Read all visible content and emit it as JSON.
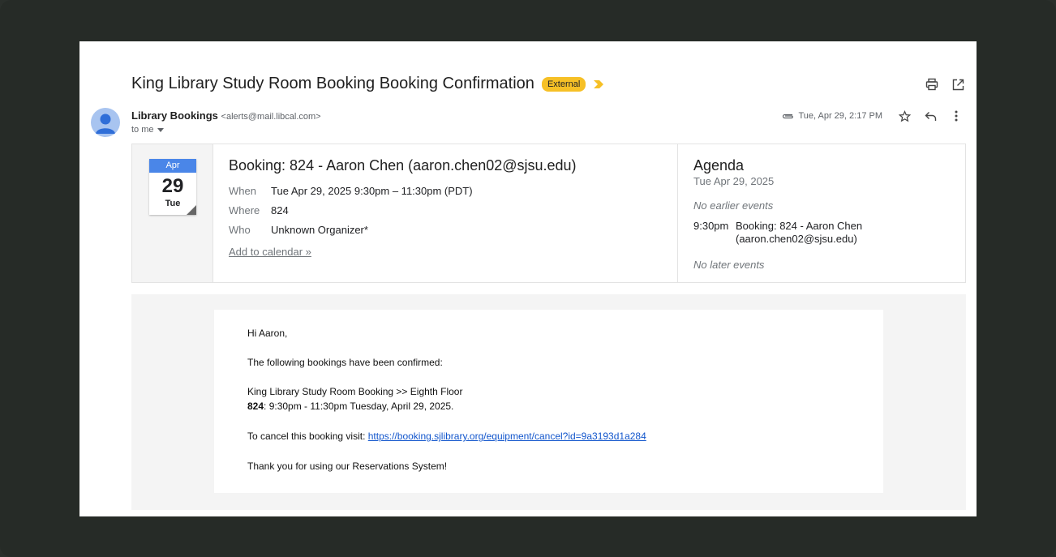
{
  "email": {
    "subject": "King Library Study Room Booking Booking Confirmation",
    "badge": "External",
    "sender_name": "Library Bookings",
    "sender_email": "<alerts@mail.libcal.com>",
    "to_label": "to me",
    "date": "Tue, Apr 29, 2:17 PM"
  },
  "invite": {
    "month": "Apr",
    "day": "29",
    "dow": "Tue",
    "title": "Booking: 824 - Aaron Chen (aaron.chen02@sjsu.edu)",
    "rows": [
      {
        "k": "When",
        "v": "Tue Apr 29, 2025 9:30pm – 11:30pm (PDT)"
      },
      {
        "k": "Where",
        "v": "824"
      },
      {
        "k": "Who",
        "v": "Unknown Organizer*"
      }
    ],
    "add_to_calendar": "Add to calendar »"
  },
  "agenda": {
    "title": "Agenda",
    "date": "Tue Apr 29, 2025",
    "no_earlier": "No earlier events",
    "event_time": "9:30pm",
    "event_desc": "Booking: 824 - Aaron Chen (aaron.chen02@sjsu.edu)",
    "no_later": "No later events"
  },
  "message": {
    "greeting": "Hi Aaron,",
    "intro": "The following bookings have been confirmed:",
    "booking_line": "King Library Study Room Booking >> Eighth Floor",
    "room": "824",
    "time_line": ": 9:30pm - 11:30pm Tuesday, April 29, 2025.",
    "cancel_prefix": "To cancel this booking visit: ",
    "cancel_url": "https://booking.sjlibrary.org/equipment/cancel?id=9a3193d1a284",
    "thanks": "Thank you for using our Reservations System!"
  },
  "colors": {
    "badge": "#f6c026",
    "calendar_header": "#4a86e8",
    "link": "#1155cc"
  }
}
